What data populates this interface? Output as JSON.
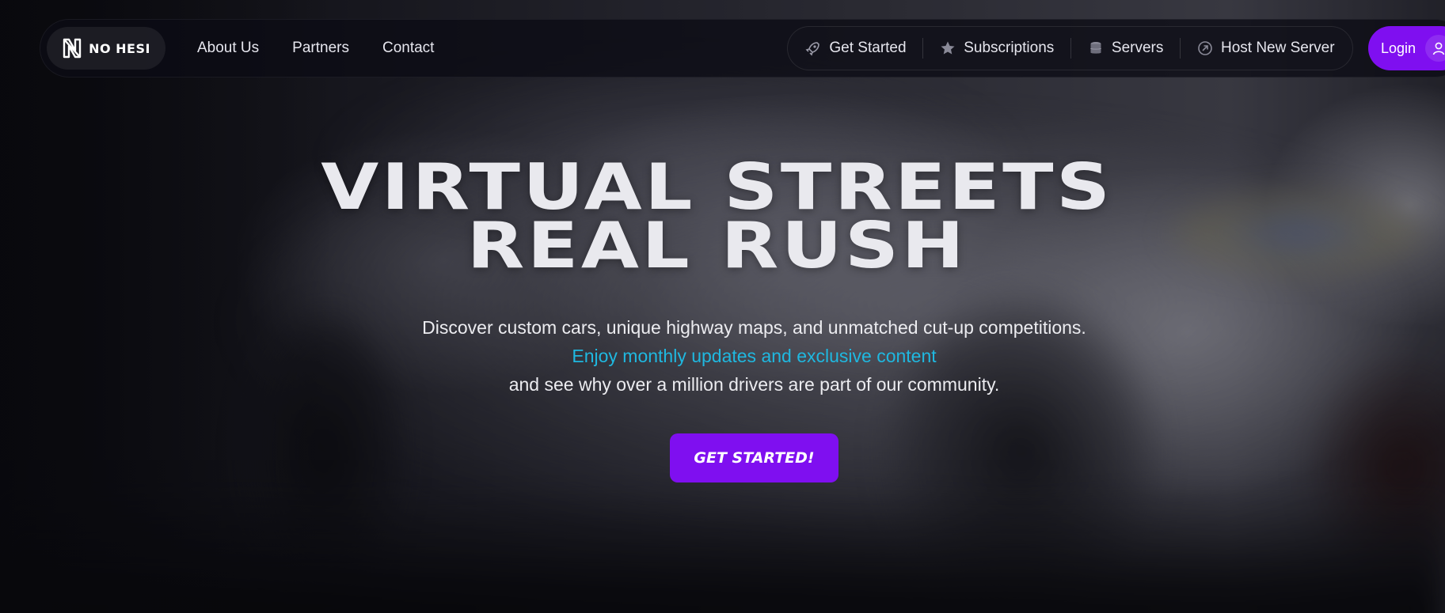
{
  "brand": {
    "name": "NO HESI",
    "icon": "nohesi-logo-icon"
  },
  "nav": {
    "links": [
      "About Us",
      "Partners",
      "Contact"
    ],
    "pill_items": [
      {
        "label": "Get Started",
        "icon": "rocket-icon"
      },
      {
        "label": "Subscriptions",
        "icon": "star-icon"
      },
      {
        "label": "Servers",
        "icon": "database-icon"
      },
      {
        "label": "Host New Server",
        "icon": "arrow-circle-icon"
      }
    ],
    "login_label": "Login"
  },
  "hero": {
    "title_line1": "VIRTUAL STREETS",
    "title_line2": "REAL RUSH",
    "subtitle_line1": "Discover custom cars, unique highway maps, and unmatched cut-up competitions.",
    "subtitle_line2": "Enjoy monthly updates and exclusive content",
    "subtitle_line3": "and see why over a million drivers are part of our community.",
    "cta_label": "GET STARTED!"
  },
  "colors": {
    "accent_purple": "#7f0ff0",
    "accent_cyan": "#1fb8e0",
    "text": "#e9e9ee"
  }
}
